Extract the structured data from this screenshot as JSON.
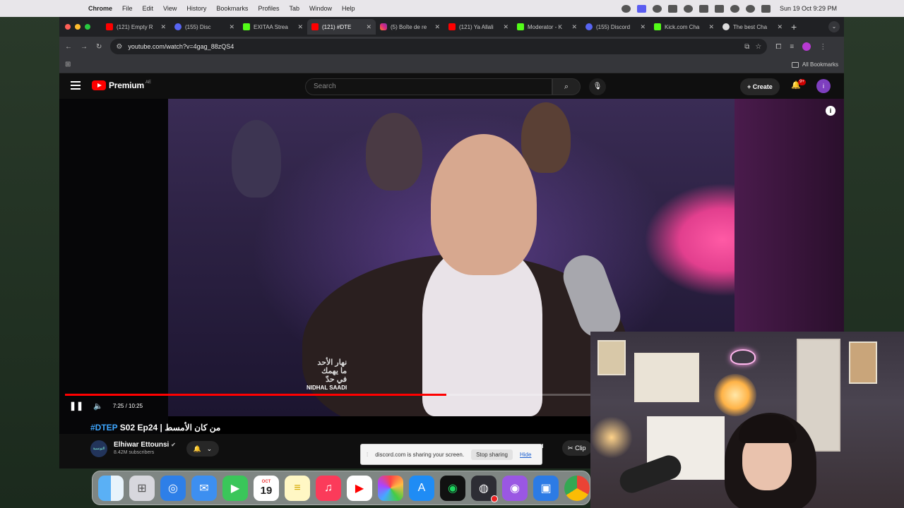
{
  "menubar": {
    "app_name": "Chrome",
    "menus": [
      "File",
      "Edit",
      "View",
      "History",
      "Bookmarks",
      "Profiles",
      "Tab",
      "Window",
      "Help"
    ],
    "clock": "Sun 19 Oct  9:29 PM"
  },
  "browser": {
    "tabs": [
      {
        "title": "(121) Empty R",
        "icon": "youtube"
      },
      {
        "title": "(155) Disc",
        "icon": "discord"
      },
      {
        "title": "EXITAA Strea",
        "icon": "kick"
      },
      {
        "title": "(121) #DTE",
        "icon": "youtube",
        "active": true
      },
      {
        "title": "(5) Boîte de re",
        "icon": "instagram"
      },
      {
        "title": "(121) Ya Allali",
        "icon": "youtube"
      },
      {
        "title": "Moderator - K",
        "icon": "kick"
      },
      {
        "title": "(155) Discord",
        "icon": "discord"
      },
      {
        "title": "Kick.com Cha",
        "icon": "kick"
      },
      {
        "title": "The best Cha",
        "icon": "generic"
      }
    ],
    "url": "youtube.com/watch?v=4gag_88zQS4",
    "bookmarks_label": "All Bookmarks"
  },
  "youtube": {
    "logo_text": "Premium",
    "country_code": "AE",
    "search_placeholder": "Search",
    "create_label": "Create",
    "notification_count": "9+",
    "avatar_letter": "i",
    "player": {
      "time": "7:25 / 10:25",
      "progress_fraction": 0.71,
      "watermark_arabic": "نهار الأحد\nما يهمك\nفي حدّ",
      "watermark_name": "NIDHAL SAADI"
    },
    "video": {
      "title_tag": "#DTEP",
      "title_rest": " S02 Ep24 | من كان الأمسط",
      "channel_name": "Elhiwar Ettounsi",
      "channel_avatar_text": "التونسية",
      "subscribers": "8.42M subscribers",
      "download_partial": "ad",
      "clip_label": "Clip"
    }
  },
  "share_bar": {
    "message": "discord.com is sharing your screen.",
    "stop_label": "Stop sharing",
    "hide_label": "Hide"
  },
  "dock": {
    "apps": [
      "Finder",
      "Launchpad",
      "Safari",
      "Mail",
      "FaceTime",
      "Calendar",
      "Notes",
      "Music",
      "YouTube",
      "Photos",
      "App Store",
      "Spotify",
      "OBS",
      "Podcasts",
      "Screen Recorder",
      "Chrome"
    ],
    "calendar_month": "OCT",
    "calendar_day": "19"
  }
}
